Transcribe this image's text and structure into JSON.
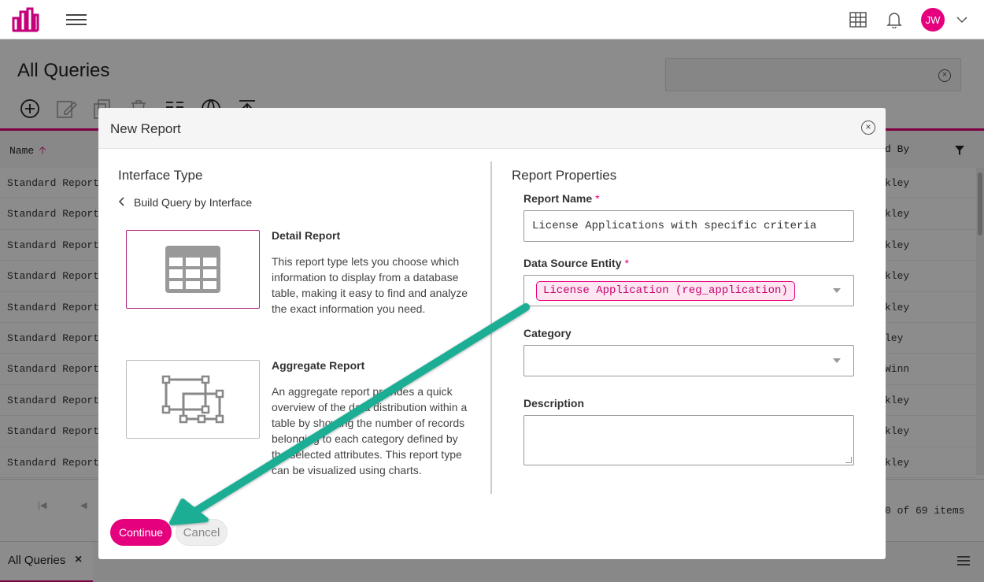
{
  "header": {
    "user_initials": "JW",
    "accent_color": "#e5007d"
  },
  "page": {
    "title": "All Queries",
    "grid": {
      "columns": [
        "Name",
        "d By"
      ],
      "rows": [
        {
          "name": "Standard Report -",
          "by": "kley"
        },
        {
          "name": "Standard Report -",
          "by": "kley"
        },
        {
          "name": "Standard Report -",
          "by": "kley"
        },
        {
          "name": "Standard Report -",
          "by": "kley"
        },
        {
          "name": "Standard Report -",
          "by": "kley"
        },
        {
          "name": "Standard Report -",
          "by": "ley"
        },
        {
          "name": "Standard Report -",
          "by": "Winn"
        },
        {
          "name": "Standard Report -",
          "by": "kley"
        },
        {
          "name": "Standard Report -",
          "by": "kley"
        },
        {
          "name": "Standard Report -",
          "by": "kley"
        }
      ]
    },
    "pager_info": "0 of 69 items",
    "bottom_tab": "All Queries"
  },
  "modal": {
    "title": "New Report",
    "left": {
      "title": "Interface Type",
      "back_link": "Build Query by Interface",
      "types": [
        {
          "title": "Detail Report",
          "description": "This report type lets you choose which information to display from a database table, making it easy to find and analyze the exact information you need."
        },
        {
          "title": "Aggregate Report",
          "description": "An aggregate report provides a quick overview of the data distribution within a table by showing the number of records belonging to each category defined by the selected attributes. This report type can be visualized using charts."
        }
      ]
    },
    "right": {
      "title": "Report Properties",
      "report_name_label": "Report Name",
      "report_name_value": "License Applications with specific criteria",
      "data_source_label": "Data Source Entity",
      "data_source_chip": "License Application (reg_application)",
      "category_label": "Category",
      "description_label": "Description"
    },
    "buttons": {
      "continue": "Continue",
      "cancel": "Cancel"
    }
  }
}
